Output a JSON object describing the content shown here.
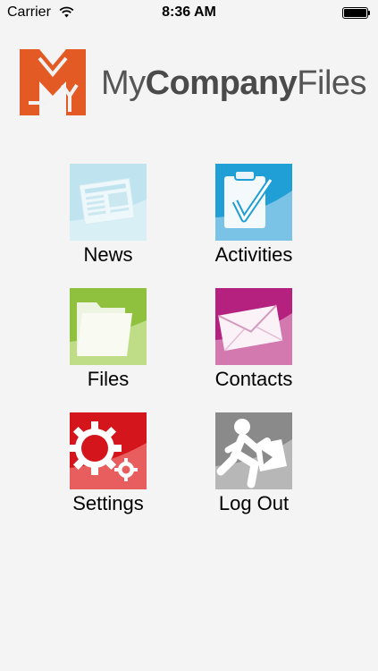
{
  "status_bar": {
    "carrier": "Carrier",
    "time": "8:36 AM",
    "icons": [
      "wifi-icon",
      "battery-icon"
    ]
  },
  "header": {
    "brand_light_1": "My",
    "brand_bold": "Company",
    "brand_light_2": "Files",
    "logo_icon": "mycompanyfiles-logo-icon",
    "brand_color": "#e35a24"
  },
  "menu": {
    "items": [
      {
        "label": "News",
        "icon": "newspaper-icon",
        "color": "#bfe3ef"
      },
      {
        "label": "Activities",
        "icon": "clipboard-check-icon",
        "color": "#1f9fd6"
      },
      {
        "label": "Files",
        "icon": "folder-icon",
        "color": "#8fc13f"
      },
      {
        "label": "Contacts",
        "icon": "envelope-icon",
        "color": "#b5217f"
      },
      {
        "label": "Settings",
        "icon": "gear-icon",
        "color": "#d4151b"
      },
      {
        "label": "Log Out",
        "icon": "running-man-icon",
        "color": "#8a8a8a"
      }
    ]
  }
}
